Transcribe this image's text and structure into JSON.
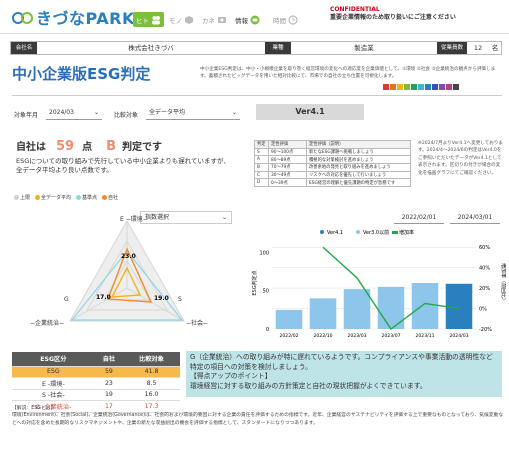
{
  "header": {
    "logo_text": "きづなPARK",
    "nav": [
      {
        "label": "ヒト",
        "icon": "people-icon",
        "color": "#7cbf3f",
        "active": true
      },
      {
        "label": "モノ",
        "icon": "cube-icon",
        "color": "#999999",
        "active": false
      },
      {
        "label": "カネ",
        "icon": "money-icon",
        "color": "#999999",
        "active": false
      },
      {
        "label": "情報",
        "icon": "chat-icon",
        "color": "#7cbf3f",
        "active": true
      },
      {
        "label": "時間",
        "icon": "clock-icon",
        "color": "#999999",
        "active": false
      }
    ],
    "confidential_title": "CONFIDENTIAL",
    "confidential_note": "重要企業情報のため取り扱いにご注意ください"
  },
  "company": {
    "name_label": "会社名",
    "name_value": "株式会社きづバ",
    "industry_label": "業種",
    "industry_value": "製造業",
    "employees_label": "従業員数",
    "employees_value": "12",
    "employees_unit": "名"
  },
  "title": "中小企業版ESG判定",
  "description": "中小企業ESG判定は、中小・小規模企業を取り巻く経営環境の変化への適応度を企業価値として、①環境 ②社会 ③企業統治の観点から評価します。蓄積されたビッグデータを用いた相対比較にて、市場での自社の立ち位置を可視化します。",
  "colorbar": [
    "#d93a3a",
    "#e8712a",
    "#f2b21b",
    "#7cbf3f",
    "#2a9d5c",
    "#3fb6c9",
    "#2a7fbf",
    "#3a4fb0",
    "#7a4fb0",
    "#c0407a",
    "#444444"
  ],
  "filters": {
    "period_label": "対象年月",
    "period_value": "2024/03",
    "compare_label": "比較対象",
    "compare_value": "全データ平均",
    "version_label": "Ver4.1"
  },
  "result": {
    "prefix": "自社は",
    "score": "59",
    "score_unit": "点",
    "grade": "B",
    "suffix": "判定です",
    "description": "ESGについての取り組みで先行している中小企業よりも遅れていますが、全データ平均より良い点数です。"
  },
  "judgment": {
    "headers": [
      "判定",
      "定性評価",
      "定性評価（説明）"
    ],
    "rows": [
      [
        "S",
        "90〜100点",
        "新たなESG課題へ挑戦しましょう"
      ],
      [
        "A",
        "80〜89点",
        "積極的な対策検討を進めましょう"
      ],
      [
        "B",
        "70〜79点",
        "改善余地の発見と取り組みを進めましょう"
      ],
      [
        "C",
        "30〜49点",
        "リスクへの対応を優先して行いましょう"
      ],
      [
        "D",
        "0〜39点",
        "ESG経営の理解と優先課題の特定が急務です"
      ]
    ],
    "note": "※2024/7月よりVer4.1へ変更しております。2024/4〜2024/6の判定はVer4.0をご参照いただいたデータがVer4.1として表示されます。区切りの付きが場合の変化を描画グラフにてご確認ください。"
  },
  "radar": {
    "legend": [
      {
        "label": "上限",
        "color": "#cfcfcf"
      },
      {
        "label": "全データ平均",
        "color": "#f2b21b"
      },
      {
        "label": "基準点",
        "color": "#8ed6e0"
      },
      {
        "label": "自社",
        "color": "#f28b2a"
      }
    ],
    "select_value": "指数選択",
    "axis_labels": {
      "e": "E −環境−",
      "s": "S",
      "g": "G",
      "s_sub": "−社会−",
      "g_sub": "−企業統治−"
    },
    "value_labels": [
      "23.0",
      "19.0",
      "17.0"
    ]
  },
  "trend": {
    "date_from": "2022/02/01",
    "date_to": "2024/03/01",
    "legend": [
      {
        "label": "Ver4.1",
        "color": "#2a7fbf"
      },
      {
        "label": "Ver3.0以前",
        "color": "#8ec5ea"
      },
      {
        "label": "増加率",
        "color": "#22a845"
      }
    ],
    "y_left_label": "ESG判定点",
    "y_right_label": "増加率（前回比）",
    "y_left_ticks": [
      "0",
      "50",
      "100"
    ],
    "y_right_ticks": [
      "-20%",
      "0%",
      "20%",
      "40%",
      "60%"
    ]
  },
  "chart_data": {
    "type": "bar",
    "categories": [
      "2022/02",
      "2022/10",
      "2023/03",
      "2023/07",
      "2023/11",
      "2024/03"
    ],
    "series": [
      {
        "name": "Ver3.0以前",
        "values": [
          25,
          40,
          52,
          55,
          60,
          0
        ]
      },
      {
        "name": "Ver4.1",
        "values": [
          0,
          0,
          0,
          0,
          0,
          59
        ]
      },
      {
        "name": "増加率",
        "type": "line",
        "values": [
          null,
          60,
          30,
          -20,
          5,
          0
        ]
      }
    ],
    "ylim_left": [
      0,
      120
    ],
    "ylim_right": [
      -20,
      70
    ],
    "ylabel": "ESG判定点",
    "y2label": "増加率（前回比）"
  },
  "esg_table": {
    "headers": [
      "ESG区分",
      "自社",
      "比較対象"
    ],
    "rows": [
      [
        "ESG",
        "59",
        "41.8"
      ],
      [
        "E -環境-",
        "23",
        "8.5"
      ],
      [
        "S -社会-",
        "19",
        "16.0"
      ],
      [
        "G -企業統治-",
        "17",
        "17.3"
      ]
    ]
  },
  "comment": "G（企業統治）への取り組みが特に遅れているようです。コンプライアンスや事業活動の透明性など特定の項目への対策を検討しましょう。\n【得点アップのポイント】\n環境経営に対する取り組みの方針策定と自社の現状把握がよくできています。",
  "footer": {
    "heading": "【解説：ESGとは】",
    "body": "環境(Environment)、社会(Social)、企業統治(Governance)は、社会的および環境的要因に対する企業の責任を評価するための指標です。近年、企業経営のサステナビリティを評価する上で重要なものとなっており、気候変動などへの対応を含めた長期的なリスクマネジメントや、企業の新たな収益創出の機会を評価する指標として、スタンダードになりつつあります。"
  }
}
